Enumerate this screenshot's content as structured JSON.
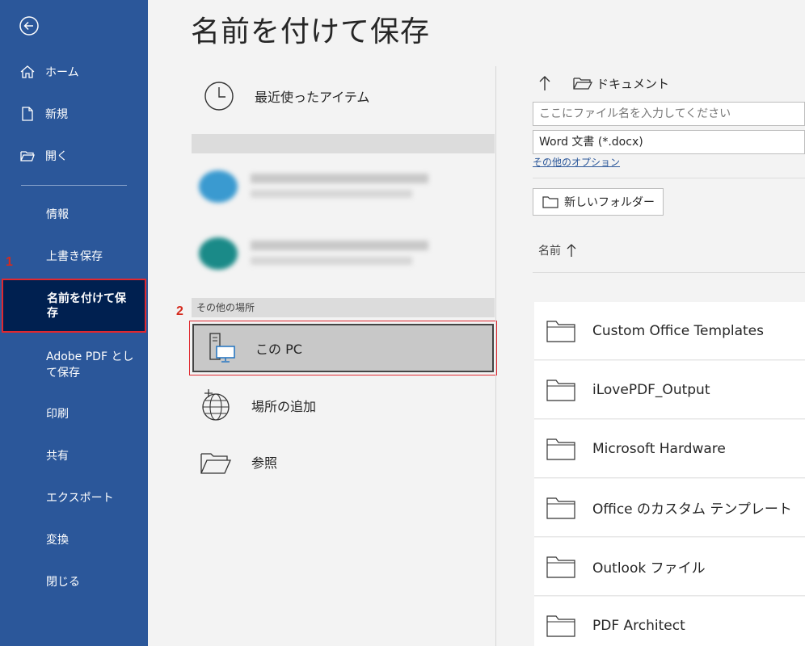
{
  "page": {
    "title": "名前を付けて保存"
  },
  "sidebar": {
    "items": [
      {
        "label": "ホーム",
        "icon": "home-icon"
      },
      {
        "label": "新規",
        "icon": "new-document-icon"
      },
      {
        "label": "開く",
        "icon": "open-folder-icon"
      }
    ],
    "sub_items": [
      {
        "label": "情報"
      },
      {
        "label": "上書き保存"
      },
      {
        "label": "名前を付けて保存",
        "active": true
      },
      {
        "label": "Adobe PDF として保存"
      },
      {
        "label": "印刷"
      },
      {
        "label": "共有"
      },
      {
        "label": "エクスポート"
      },
      {
        "label": "変換"
      },
      {
        "label": "閉じる"
      }
    ],
    "step1": "1",
    "step2": "2"
  },
  "locations": {
    "recent": "最近使ったアイテム",
    "other_header": "その他の場所",
    "this_pc": "この PC",
    "add_place": "場所の追加",
    "browse": "参照"
  },
  "right": {
    "path": "ドキュメント",
    "filename_placeholder": "ここにファイル名を入力してください",
    "filetype": "Word 文書 (*.docx)",
    "more_options": "その他のオプション",
    "new_folder": "新しいフォルダー",
    "col_name": "名前",
    "folders": [
      "Custom Office Templates",
      "iLovePDF_Output",
      "Microsoft Hardware",
      "Office のカスタム テンプレート",
      "Outlook ファイル",
      "PDF Architect"
    ]
  },
  "colors": {
    "sidebar": "#2b579a",
    "active": "#002050",
    "highlight_border": "#e0282f",
    "step": "#d52b1e"
  }
}
